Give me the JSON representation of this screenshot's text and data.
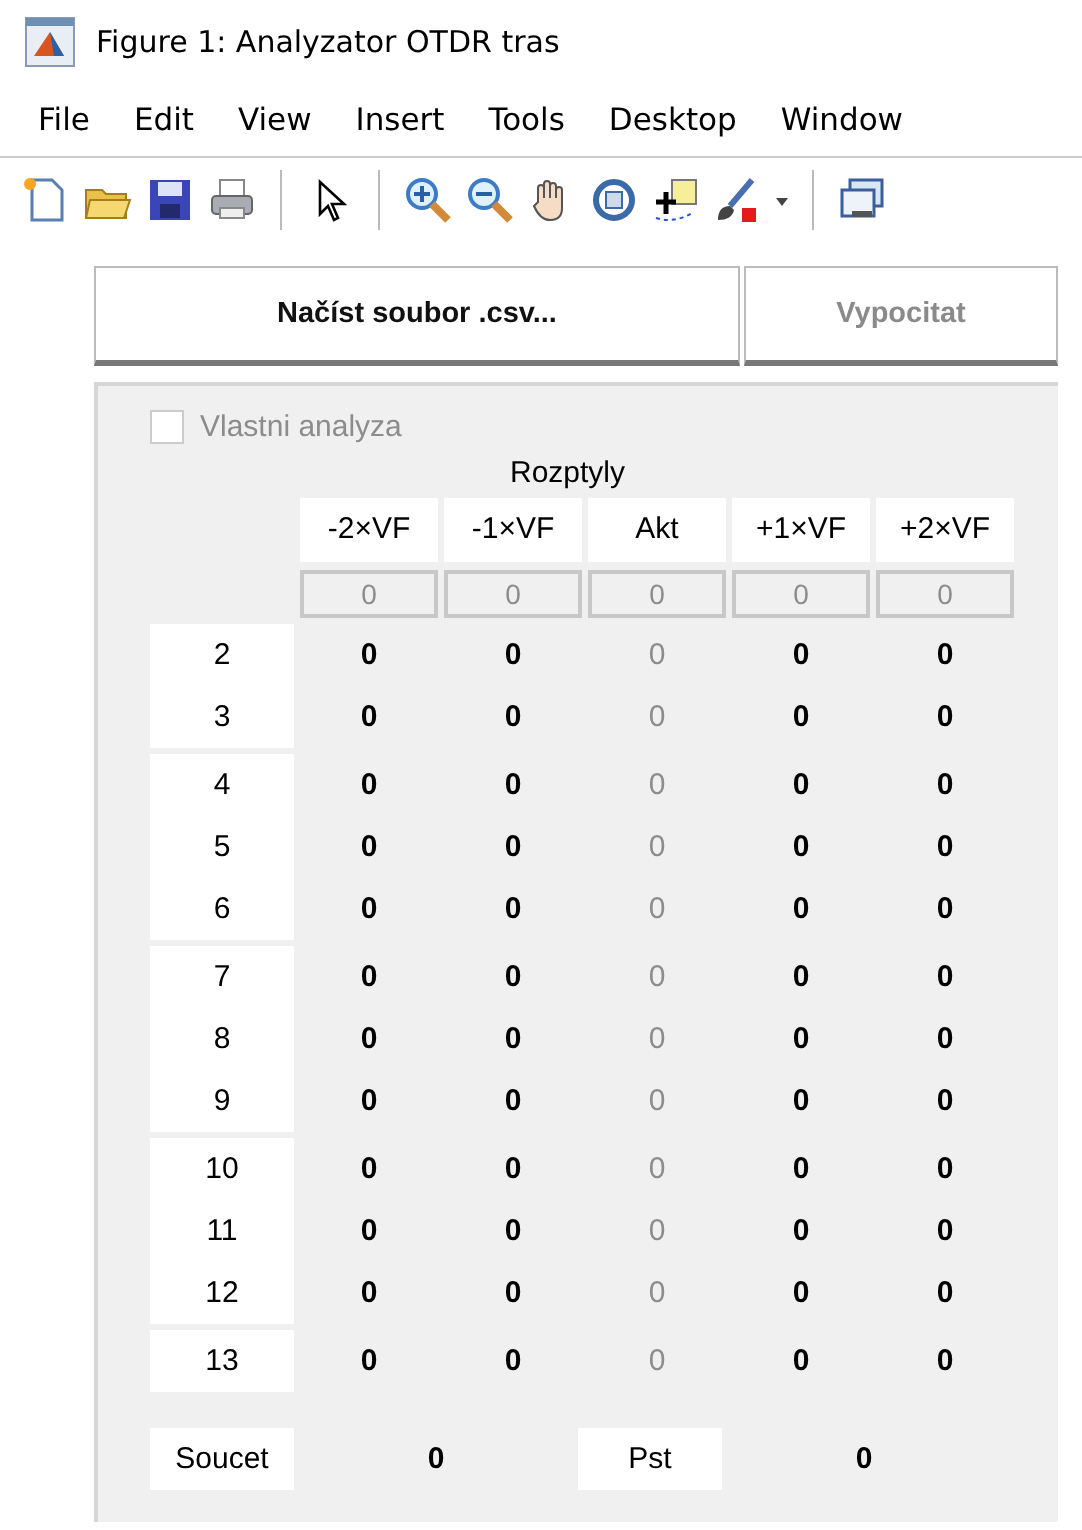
{
  "window": {
    "title": "Figure 1: Analyzator OTDR tras"
  },
  "menu": [
    "File",
    "Edit",
    "View",
    "Insert",
    "Tools",
    "Desktop",
    "Window"
  ],
  "buttons": [
    {
      "label": "Načíst soubor .csv...",
      "disabled": false
    },
    {
      "label": "Vypocitat",
      "disabled": true
    }
  ],
  "checkbox": {
    "label": "Vlastni analyza",
    "checked": false,
    "disabled": true
  },
  "table": {
    "title": "Rozptyly",
    "columns": [
      {
        "label": "-2×VF",
        "disabled": false
      },
      {
        "label": "-1×VF",
        "disabled": false
      },
      {
        "label": "Akt",
        "disabled": true
      },
      {
        "label": "+1×VF",
        "disabled": false
      },
      {
        "label": "+2×VF",
        "disabled": false
      }
    ],
    "inputs": [
      "0",
      "0",
      "0",
      "0",
      "0"
    ],
    "row_groups": [
      [
        {
          "label": "2",
          "cells": [
            "0",
            "0",
            "0",
            "0",
            "0"
          ]
        },
        {
          "label": "3",
          "cells": [
            "0",
            "0",
            "0",
            "0",
            "0"
          ]
        }
      ],
      [
        {
          "label": "4",
          "cells": [
            "0",
            "0",
            "0",
            "0",
            "0"
          ]
        },
        {
          "label": "5",
          "cells": [
            "0",
            "0",
            "0",
            "0",
            "0"
          ]
        },
        {
          "label": "6",
          "cells": [
            "0",
            "0",
            "0",
            "0",
            "0"
          ]
        }
      ],
      [
        {
          "label": "7",
          "cells": [
            "0",
            "0",
            "0",
            "0",
            "0"
          ]
        },
        {
          "label": "8",
          "cells": [
            "0",
            "0",
            "0",
            "0",
            "0"
          ]
        },
        {
          "label": "9",
          "cells": [
            "0",
            "0",
            "0",
            "0",
            "0"
          ]
        }
      ],
      [
        {
          "label": "10",
          "cells": [
            "0",
            "0",
            "0",
            "0",
            "0"
          ]
        },
        {
          "label": "11",
          "cells": [
            "0",
            "0",
            "0",
            "0",
            "0"
          ]
        },
        {
          "label": "12",
          "cells": [
            "0",
            "0",
            "0",
            "0",
            "0"
          ]
        }
      ],
      [
        {
          "label": "13",
          "cells": [
            "0",
            "0",
            "0",
            "0",
            "0"
          ]
        }
      ]
    ]
  },
  "totals": [
    {
      "label": "Soucet",
      "value": "0"
    },
    {
      "label": "Pst",
      "value": "0"
    }
  ]
}
